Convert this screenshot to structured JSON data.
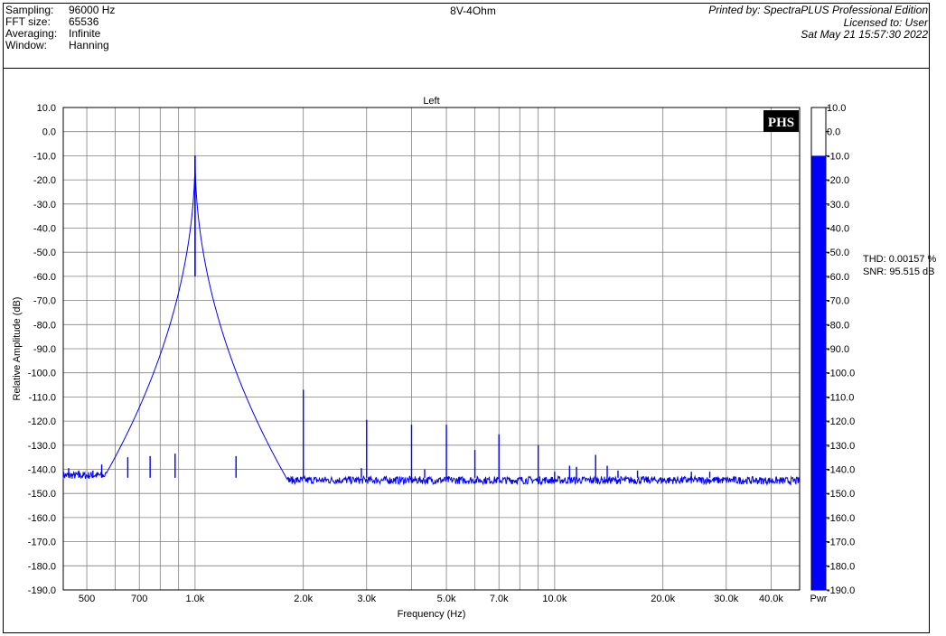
{
  "header": {
    "fields": [
      {
        "label": "Sampling:",
        "value": "96000 Hz"
      },
      {
        "label": "FFT size:",
        "value": "65536"
      },
      {
        "label": "Averaging:",
        "value": "Infinite"
      },
      {
        "label": "Window:",
        "value": "Hanning"
      }
    ],
    "title": "8V-4Ohm",
    "printed_by": "Printed by: SpectraPLUS Professional Edition",
    "licensed_to": "Licensed to: User",
    "date": "Sat May 21 15:57:30 2022"
  },
  "stats": {
    "thd": "THD: 0.00157 %",
    "snr": "SNR: 95.515 dB"
  },
  "logo": "PHS",
  "chart_data": {
    "type": "line",
    "title": "Left",
    "xlabel": "Frequency (Hz)",
    "ylabel": "Relative Amplitude (dB)",
    "x_scale": "log",
    "xlim": [
      430,
      48000
    ],
    "ylim": [
      -190,
      10
    ],
    "y_ticks": [
      "10.0",
      "0.0",
      "-10.0",
      "-20.0",
      "-30.0",
      "-40.0",
      "-50.0",
      "-60.0",
      "-70.0",
      "-80.0",
      "-90.0",
      "-100.0",
      "-110.0",
      "-120.0",
      "-130.0",
      "-140.0",
      "-150.0",
      "-160.0",
      "-170.0",
      "-180.0",
      "-190.0"
    ],
    "x_tick_labels": [
      {
        "f": 500,
        "label": "500"
      },
      {
        "f": 700,
        "label": "700"
      },
      {
        "f": 1000,
        "label": "1.0k"
      },
      {
        "f": 2000,
        "label": "2.0k"
      },
      {
        "f": 3000,
        "label": "3.0k"
      },
      {
        "f": 5000,
        "label": "5.0k"
      },
      {
        "f": 7000,
        "label": "7.0k"
      },
      {
        "f": 10000,
        "label": "10.0k"
      },
      {
        "f": 20000,
        "label": "20.0k"
      },
      {
        "f": 30000,
        "label": "30.0k"
      },
      {
        "f": 40000,
        "label": "40.0k"
      }
    ],
    "x_grid": [
      500,
      600,
      700,
      800,
      900,
      1000,
      2000,
      3000,
      4000,
      5000,
      6000,
      7000,
      8000,
      9000,
      10000,
      20000,
      30000,
      40000
    ],
    "fundamental": {
      "f": 1000,
      "db": -10.0
    },
    "noise_floor_db": -144.5,
    "series": [
      {
        "color": "#0000ff",
        "peaks": [
          {
            "f": 445,
            "db": -139.5
          },
          {
            "f": 475,
            "db": -140.5
          },
          {
            "f": 520,
            "db": -140.5
          },
          {
            "f": 550,
            "db": -138.0
          },
          {
            "f": 650,
            "db": -135.0
          },
          {
            "f": 750,
            "db": -134.5
          },
          {
            "f": 880,
            "db": -133.5
          },
          {
            "f": 1300,
            "db": -134.5
          },
          {
            "f": 2000,
            "db": -107.0
          },
          {
            "f": 2900,
            "db": -139.5
          },
          {
            "f": 3000,
            "db": -119.5
          },
          {
            "f": 4000,
            "db": -121.5
          },
          {
            "f": 4350,
            "db": -140.0
          },
          {
            "f": 5000,
            "db": -121.5
          },
          {
            "f": 6000,
            "db": -132.0
          },
          {
            "f": 7000,
            "db": -125.5
          },
          {
            "f": 9000,
            "db": -130.0
          },
          {
            "f": 10000,
            "db": -141.0
          },
          {
            "f": 11000,
            "db": -138.5
          },
          {
            "f": 11500,
            "db": -139.0
          },
          {
            "f": 13000,
            "db": -134.0
          },
          {
            "f": 14000,
            "db": -138.5
          },
          {
            "f": 15000,
            "db": -140.5
          },
          {
            "f": 17000,
            "db": -140.5
          },
          {
            "f": 24000,
            "db": -141.0
          },
          {
            "f": 27000,
            "db": -141.0
          }
        ]
      }
    ]
  },
  "level_bar": {
    "label": "Pwr",
    "value_db": -10.0,
    "color": "#0000ff",
    "ticks": [
      "10.0",
      "0.0",
      "-10.0",
      "-20.0",
      "-30.0",
      "-40.0",
      "-50.0",
      "-60.0",
      "-70.0",
      "-80.0",
      "-90.0",
      "-100.0",
      "-110.0",
      "-120.0",
      "-130.0",
      "-140.0",
      "-150.0",
      "-160.0",
      "-170.0",
      "-180.0",
      "-190.0"
    ]
  }
}
